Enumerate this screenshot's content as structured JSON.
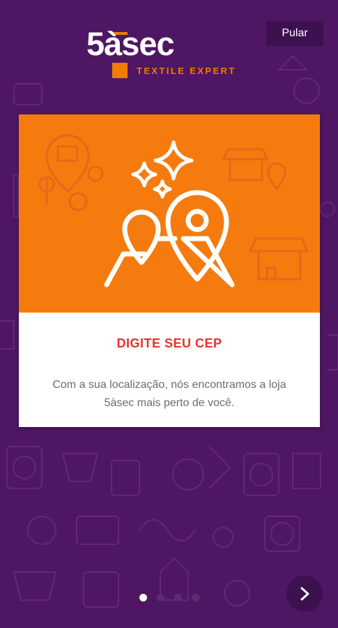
{
  "brand": {
    "logo_text": "5àsec",
    "tagline": "TEXTILE EXPERT"
  },
  "header": {
    "skip_label": "Pular"
  },
  "card": {
    "title": "DIGITE SEU CEP",
    "description": "Com a sua localização, nós encontramos a loja 5àsec mais perto de você.",
    "illustration_icon": "map-pin-icon"
  },
  "pagination": {
    "current_page": 1,
    "total_pages": 4
  },
  "navigation": {
    "next_icon": "chevron-right-icon"
  },
  "colors": {
    "background": "#4f1763",
    "accent_orange": "#f57b0e",
    "title_red": "#e5322d",
    "button_dark": "#3d1050"
  }
}
